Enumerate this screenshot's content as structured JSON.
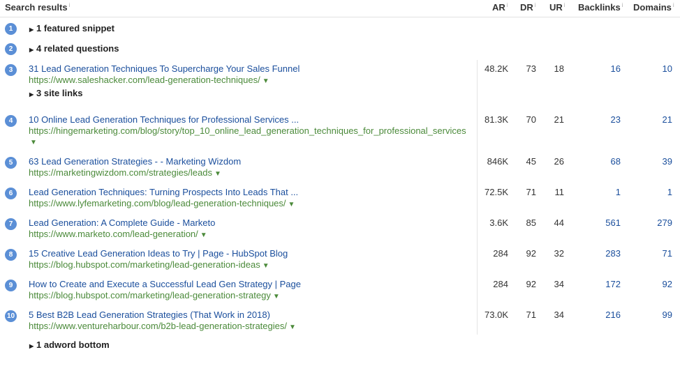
{
  "header": {
    "search_results": "Search results",
    "ar": "AR",
    "dr": "DR",
    "ur": "UR",
    "backlinks": "Backlinks",
    "domains": "Domains",
    "info_glyph": "i"
  },
  "expander_glyph": "▶",
  "caret_glyph": "▼",
  "rows": [
    {
      "num": "1",
      "label": "1 featured snippet"
    },
    {
      "num": "2",
      "label": "4 related questions"
    },
    {
      "num": "3",
      "title": "31 Lead Generation Techniques To Supercharge Your Sales Funnel",
      "url": "https://www.saleshacker.com/lead-generation-techniques/",
      "sub": "3 site links",
      "ar": "48.2K",
      "dr": "73",
      "ur": "18",
      "backlinks": "16",
      "domains": "10"
    },
    {
      "num": "4",
      "title": "10 Online Lead Generation Techniques for Professional Services ...",
      "url": "https://hingemarketing.com/blog/story/top_10_online_lead_generation_techniques_for_professional_services",
      "ar": "81.3K",
      "dr": "70",
      "ur": "21",
      "backlinks": "23",
      "domains": "21"
    },
    {
      "num": "5",
      "title": "63 Lead Generation Strategies - - Marketing Wizdom",
      "url": "https://marketingwizdom.com/strategies/leads",
      "ar": "846K",
      "dr": "45",
      "ur": "26",
      "backlinks": "68",
      "domains": "39"
    },
    {
      "num": "6",
      "title": "Lead Generation Techniques: Turning Prospects Into Leads That ...",
      "url": "https://www.lyfemarketing.com/blog/lead-generation-techniques/",
      "ar": "72.5K",
      "dr": "71",
      "ur": "11",
      "backlinks": "1",
      "domains": "1"
    },
    {
      "num": "7",
      "title": "Lead Generation: A Complete Guide - Marketo",
      "url": "https://www.marketo.com/lead-generation/",
      "ar": "3.6K",
      "dr": "85",
      "ur": "44",
      "backlinks": "561",
      "domains": "279"
    },
    {
      "num": "8",
      "title": "15 Creative Lead Generation Ideas to Try | Page - HubSpot Blog",
      "url": "https://blog.hubspot.com/marketing/lead-generation-ideas",
      "ar": "284",
      "dr": "92",
      "ur": "32",
      "backlinks": "283",
      "domains": "71"
    },
    {
      "num": "9",
      "title": "How to Create and Execute a Successful Lead Gen Strategy | Page",
      "url": "https://blog.hubspot.com/marketing/lead-generation-strategy",
      "ar": "284",
      "dr": "92",
      "ur": "34",
      "backlinks": "172",
      "domains": "92"
    },
    {
      "num": "10",
      "title": "5 Best B2B Lead Generation Strategies (That Work in 2018)",
      "url": "https://www.ventureharbour.com/b2b-lead-generation-strategies/",
      "ar": "73.0K",
      "dr": "71",
      "ur": "34",
      "backlinks": "216",
      "domains": "99"
    }
  ],
  "footer": {
    "label": "1 adword bottom"
  }
}
